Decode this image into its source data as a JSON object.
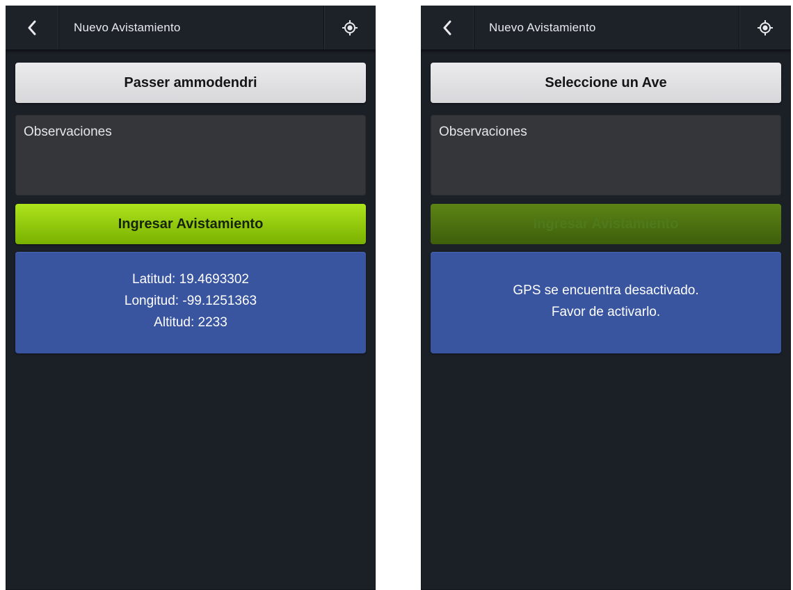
{
  "screens": [
    {
      "app_bar": {
        "title": "Nuevo Avistamiento",
        "back_icon": "chevron-left-icon",
        "location_icon": "my-location-icon"
      },
      "species_button": "Passer ammodendri",
      "observations_placeholder": "Observaciones",
      "submit_button": {
        "label": "Ingresar Avistamiento",
        "enabled": true
      },
      "info_panel": {
        "latitude": "Latitud: 19.4693302",
        "longitude": "Longitud: -99.1251363",
        "altitude": "Altitud: 2233"
      }
    },
    {
      "app_bar": {
        "title": "Nuevo Avistamiento",
        "back_icon": "chevron-left-icon",
        "location_icon": "my-location-icon"
      },
      "species_button": "Seleccione un Ave",
      "observations_placeholder": "Observaciones",
      "submit_button": {
        "label": "Ingresar Avistamiento",
        "enabled": false
      },
      "info_panel": {
        "message_line1": "GPS se encuentra desactivado.",
        "message_line2": "Favor de activarlo."
      }
    }
  ],
  "colors": {
    "screen_background": "#1b1f26",
    "action_bar": "#1d2128",
    "species_button": "#e2e2e4",
    "observations_field": "#34363a",
    "submit_enabled": "#8fc40c",
    "submit_disabled": "#4b6f10",
    "info_panel": "#3955a0"
  }
}
